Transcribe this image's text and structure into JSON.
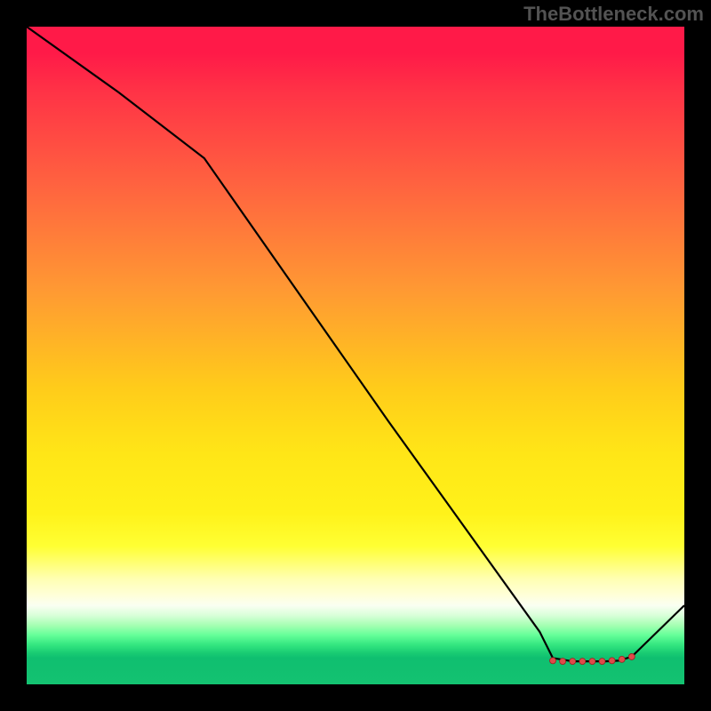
{
  "watermark": "TheBottleneck.com",
  "chart_data": {
    "type": "line",
    "title": "",
    "xlabel": "",
    "ylabel": "",
    "xlim": [
      0,
      100
    ],
    "ylim": [
      0,
      100
    ],
    "series": [
      {
        "name": "curve",
        "x": [
          0,
          14,
          27,
          55,
          78,
          80,
          83,
          85,
          88,
          90,
          92,
          100
        ],
        "values": [
          100,
          90,
          80,
          40,
          8,
          4,
          3.5,
          3.5,
          3.5,
          3.6,
          4.2,
          12
        ]
      }
    ],
    "markers": {
      "x": [
        80,
        81.5,
        83,
        84.5,
        86,
        87.5,
        89,
        90.5,
        92
      ],
      "values": [
        3.6,
        3.5,
        3.5,
        3.5,
        3.5,
        3.5,
        3.6,
        3.8,
        4.2
      ]
    },
    "grid": false,
    "legend": false
  }
}
